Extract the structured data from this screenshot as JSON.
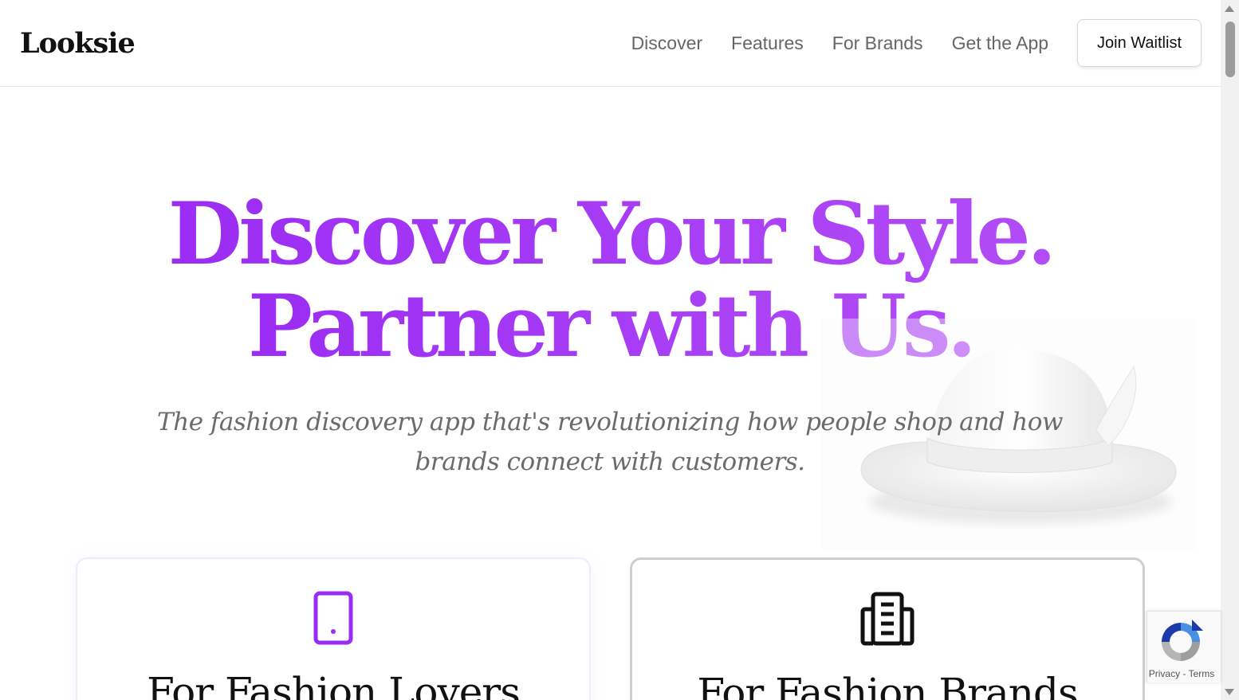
{
  "header": {
    "logo": "Looksie",
    "nav": [
      {
        "label": "Discover"
      },
      {
        "label": "Features"
      },
      {
        "label": "For Brands"
      },
      {
        "label": "Get the App"
      }
    ],
    "cta_label": "Join Waitlist"
  },
  "hero": {
    "title_line1": "Discover Your Style.",
    "title_line2": "Partner with Us.",
    "subtitle": "The fashion discovery app that's revolutionizing how people shop and how brands connect with customers."
  },
  "cards": [
    {
      "title": "For Fashion Lovers",
      "icon": "tablet-icon",
      "icon_color": "#9b2cf4"
    },
    {
      "title": "For Fashion Brands",
      "icon": "building-icon",
      "icon_color": "#111111"
    }
  ],
  "recaptcha": {
    "privacy": "Privacy",
    "separator": "-",
    "terms": "Terms"
  },
  "colors": {
    "accent": "#9b2cf4",
    "accent_light": "#b24cf7",
    "text_muted": "#6b6b6b"
  }
}
